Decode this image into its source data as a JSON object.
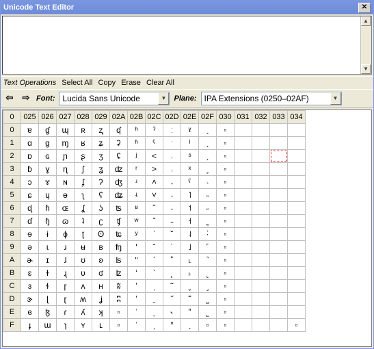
{
  "window": {
    "title": "Unicode Text Editor"
  },
  "editor": {
    "text": ""
  },
  "ops": {
    "label": "Text Operations",
    "select_all": "Select All",
    "copy": "Copy",
    "erase": "Erase",
    "clear_all": "Clear All"
  },
  "nav": {
    "prev": "⇦",
    "next": "⇨",
    "font_label": "Font:",
    "font_value": "Lucida Sans Unicode",
    "plane_label": "Plane:",
    "plane_value": "IPA Extensions (0250–02AF)"
  },
  "grid": {
    "corner": "0",
    "cols": [
      "025",
      "026",
      "027",
      "028",
      "029",
      "02A",
      "02B",
      "02C",
      "02D",
      "02E",
      "02F",
      "030",
      "031",
      "032",
      "033",
      "034"
    ],
    "rows": [
      "0",
      "1",
      "2",
      "3",
      "4",
      "5",
      "6",
      "7",
      "8",
      "9",
      "A",
      "B",
      "C",
      "D",
      "E",
      "F"
    ],
    "cells": [
      [
        "ɐ",
        "ɠ",
        "ɰ",
        "ʀ",
        "ʐ",
        "ʠ",
        "ʰ",
        "ˀ",
        "ː",
        "ˠ",
        "˰",
        "▫",
        "",
        "",
        "",
        ""
      ],
      [
        "ɑ",
        "ɡ",
        "ɱ",
        "ʁ",
        "ʑ",
        "ʡ",
        "ʱ",
        "ˁ",
        "ˑ",
        "ˡ",
        "˱",
        "▫",
        "",
        "",
        "",
        ""
      ],
      [
        "ɒ",
        "ɢ",
        "ɲ",
        "ʂ",
        "ʒ",
        "ʢ",
        "ʲ",
        "˂",
        "˒",
        "ˢ",
        "˲",
        "▫",
        "",
        "",
        "",
        ""
      ],
      [
        "ɓ",
        "ɣ",
        "ɳ",
        "ʃ",
        "ʓ",
        "ʣ",
        "ʳ",
        "˃",
        "˓",
        "ˣ",
        "˳",
        "▫",
        "",
        "",
        "",
        ""
      ],
      [
        "ɔ",
        "ɤ",
        "ɴ",
        "ʄ",
        "ʔ",
        "ʤ",
        "ʴ",
        "˄",
        "˔",
        "ˤ",
        "˴",
        "▫",
        "",
        "",
        "",
        ""
      ],
      [
        "ɕ",
        "ɥ",
        "ɵ",
        "ʅ",
        "ʕ",
        "ʥ",
        "ʵ",
        "˅",
        "˕",
        "˥",
        "˵",
        "▫",
        "",
        "",
        "",
        ""
      ],
      [
        "ɖ",
        "ɦ",
        "ɶ",
        "ʆ",
        "ʖ",
        "ʦ",
        "ʶ",
        "ˆ",
        "˖",
        "˦",
        "˶",
        "▫",
        "",
        "",
        "",
        ""
      ],
      [
        "ɗ",
        "ɧ",
        "ɷ",
        "ʇ",
        "ʗ",
        "ʧ",
        "ʷ",
        "ˇ",
        "˗",
        "˧",
        "˷",
        "▫",
        "",
        "",
        "",
        ""
      ],
      [
        "ɘ",
        "ɨ",
        "ɸ",
        "ʈ",
        "ʘ",
        "ʨ",
        "ʸ",
        "ˈ",
        "˘",
        "˨",
        "˸",
        "▫",
        "",
        "",
        "",
        ""
      ],
      [
        "ə",
        "ɩ",
        "ɹ",
        "ʉ",
        "ʙ",
        "ʩ",
        "ʹ",
        "ˉ",
        "˙",
        "˩",
        "˹",
        "▫",
        "",
        "",
        "",
        ""
      ],
      [
        "ɚ",
        "ɪ",
        "ɺ",
        "ʊ",
        "ʚ",
        "ʪ",
        "ʺ",
        "ˊ",
        "˚",
        "˪",
        "˺",
        "▫",
        "",
        "",
        "",
        ""
      ],
      [
        "ɛ",
        "ɫ",
        "ɻ",
        "ʋ",
        "ʛ",
        "ʫ",
        "ʻ",
        "ˋ",
        "˛",
        "˫",
        "˻",
        "▫",
        "",
        "",
        "",
        ""
      ],
      [
        "ɜ",
        "ɬ",
        "ɼ",
        "ʌ",
        "ʜ",
        "ʬ",
        "ʼ",
        "ˌ",
        "˜",
        "ˬ",
        "˼",
        "▫",
        "",
        "",
        "",
        ""
      ],
      [
        "ɝ",
        "ɭ",
        "ɽ",
        "ʍ",
        "ʝ",
        "ʭ",
        "ʽ",
        "ˍ",
        "˝",
        "˭",
        "˽",
        "▫",
        "",
        "",
        "",
        ""
      ],
      [
        "ɞ",
        "ɮ",
        "ɾ",
        "ʎ",
        "ʞ",
        "▫",
        "ʾ",
        "ˎ",
        "˞",
        "ˮ",
        "˾",
        "▫",
        "",
        "",
        "",
        ""
      ],
      [
        "ɟ",
        "ɯ",
        "ɿ",
        "ʏ",
        "ʟ",
        "▫",
        "ʿ",
        "ˏ",
        "˟",
        "˯",
        "▫",
        "▫",
        "",
        "",
        "",
        "▫"
      ]
    ],
    "selected": {
      "row": 2,
      "col": 14
    }
  }
}
